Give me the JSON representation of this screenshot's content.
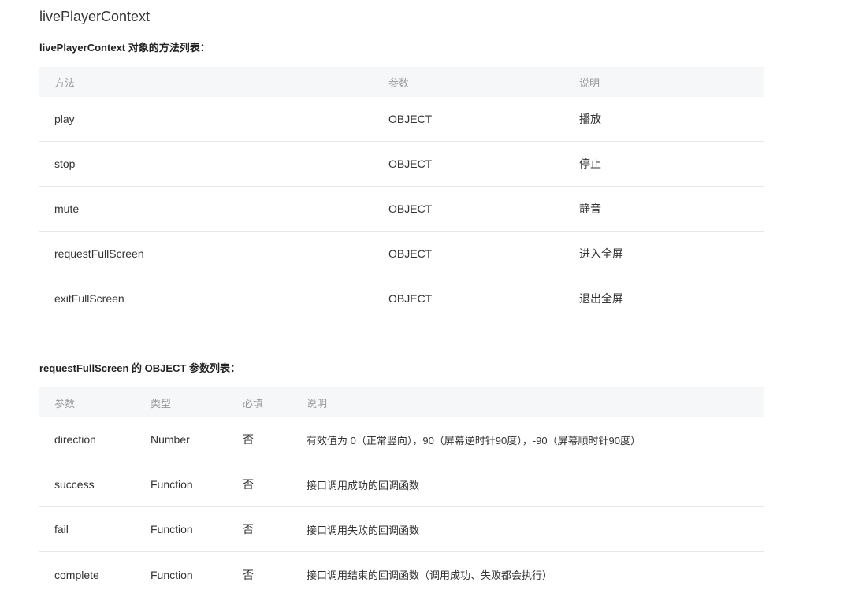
{
  "page": {
    "title": "livePlayerContext"
  },
  "methods_section": {
    "heading": "livePlayerContext 对象的方法列表：",
    "columns": [
      "方法",
      "参数",
      "说明"
    ],
    "rows": [
      [
        "play",
        "OBJECT",
        "播放"
      ],
      [
        "stop",
        "OBJECT",
        "停止"
      ],
      [
        "mute",
        "OBJECT",
        "静音"
      ],
      [
        "requestFullScreen",
        "OBJECT",
        "进入全屏"
      ],
      [
        "exitFullScreen",
        "OBJECT",
        "退出全屏"
      ]
    ]
  },
  "params_section": {
    "heading": "requestFullScreen 的 OBJECT 参数列表：",
    "columns": [
      "参数",
      "类型",
      "必填",
      "说明"
    ],
    "rows": [
      [
        "direction",
        "Number",
        "否",
        "有效值为 0（正常竖向），90（屏幕逆时针90度），-90（屏幕顺时针90度）"
      ],
      [
        "success",
        "Function",
        "否",
        "接口调用成功的回调函数"
      ],
      [
        "fail",
        "Function",
        "否",
        "接口调用失败的回调函数"
      ],
      [
        "complete",
        "Function",
        "否",
        "接口调用结束的回调函数（调用成功、失败都会执行）"
      ]
    ]
  }
}
